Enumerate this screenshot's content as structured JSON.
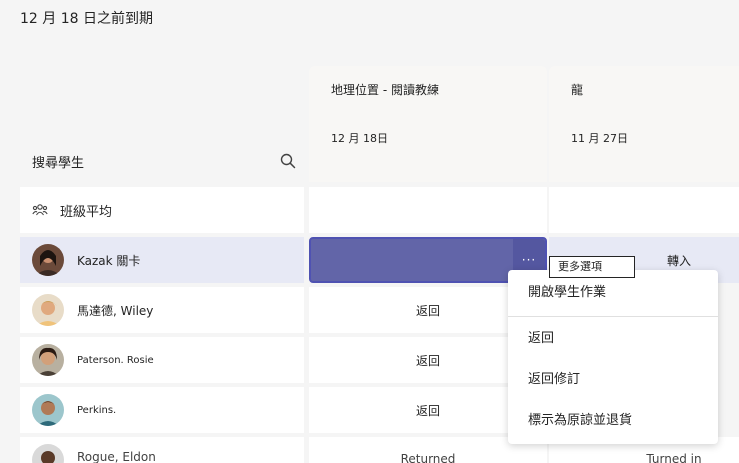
{
  "page": {
    "title": "12 月 18 日之前到期"
  },
  "search": {
    "label": "搜尋學生"
  },
  "columns": [
    {
      "title": "地理位置 - 閱讀教練",
      "date": "12 月 18日"
    },
    {
      "title": "龍",
      "date": "11 月 27日"
    }
  ],
  "class_average": {
    "label": "班級平均"
  },
  "students": [
    {
      "name": "Kazak 關卡",
      "col1": "",
      "col2": "轉入"
    },
    {
      "name": "馬達德, Wiley",
      "col1": "返回",
      "col2": ""
    },
    {
      "name": "Paterson. Rosie",
      "col1": "返回",
      "col2": ""
    },
    {
      "name": "Perkins.",
      "col1": "返回",
      "col2": ""
    },
    {
      "name": "Rogue, Eldon",
      "col1": "Returned",
      "col2": "Turned in"
    }
  ],
  "selected_cell": {
    "more_label": "···"
  },
  "tooltip": {
    "text": "更多選項"
  },
  "context_menu": {
    "items": [
      "開啟學生作業",
      "返回",
      "返回修訂",
      "標示為原諒並退貨"
    ]
  },
  "colors": {
    "accent": "#6265a8",
    "accent_border": "#4f52b2",
    "selected_row": "#e7e9f5",
    "background": "#f5f5f5"
  }
}
